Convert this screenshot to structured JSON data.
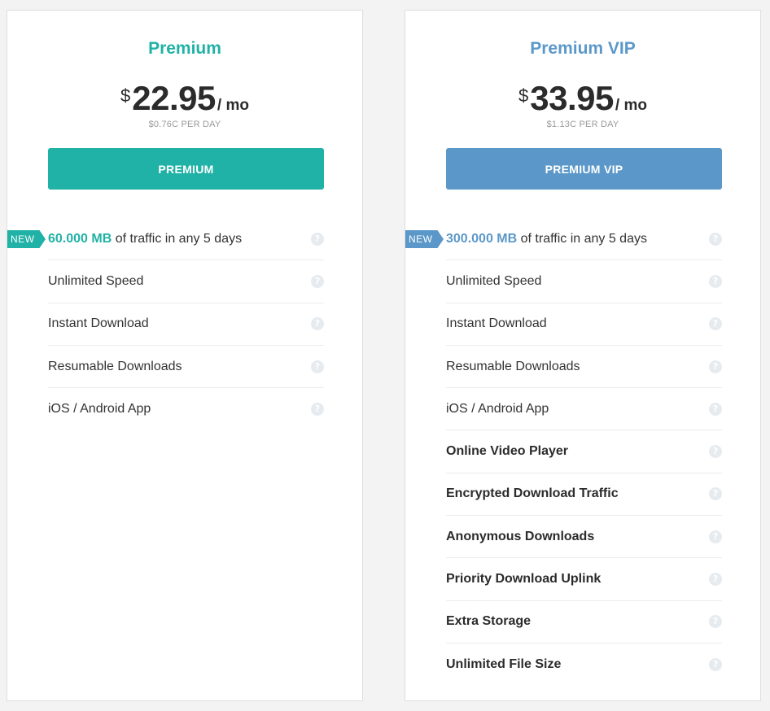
{
  "colors": {
    "premium_accent": "#20b2a6",
    "vip_accent": "#5b98c9",
    "help_icon": "#e6ebf0"
  },
  "plans": [
    {
      "title": "Premium",
      "currency": "$",
      "amount": "22.95",
      "period": "/ mo",
      "per_day": "$0.76C PER DAY",
      "button_label": "PREMIUM",
      "new_badge": "NEW",
      "traffic_value": "60.000 MB",
      "traffic_rest": "of traffic in any 5 days",
      "features": [
        "Unlimited Speed",
        "Instant Download",
        "Resumable Downloads",
        "iOS / Android App"
      ],
      "bold_features": []
    },
    {
      "title": "Premium VIP",
      "currency": "$",
      "amount": "33.95",
      "period": "/ mo",
      "per_day": "$1.13C PER DAY",
      "button_label": "PREMIUM VIP",
      "new_badge": "NEW",
      "traffic_value": "300.000 MB",
      "traffic_rest": "of traffic in any 5 days",
      "features": [
        "Unlimited Speed",
        "Instant Download",
        "Resumable Downloads",
        "iOS / Android App"
      ],
      "bold_features": [
        "Online Video Player",
        "Encrypted Download Traffic",
        "Anonymous Downloads",
        "Priority Download Uplink",
        "Extra Storage",
        "Unlimited File Size"
      ]
    }
  ],
  "help_icon_glyph": "?"
}
